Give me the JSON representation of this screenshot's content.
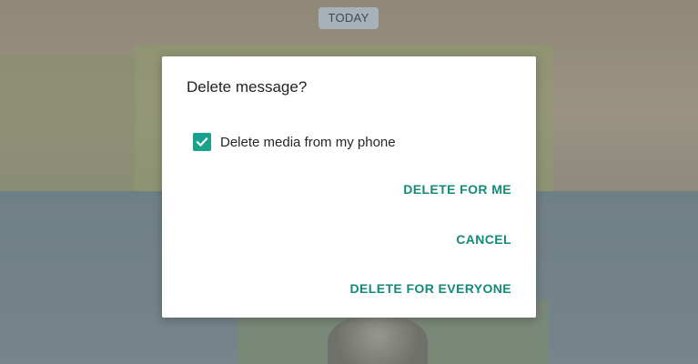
{
  "chat": {
    "date_chip": "TODAY"
  },
  "dialog": {
    "title": "Delete message?",
    "checkbox": {
      "label": "Delete media from my phone",
      "checked": true
    },
    "actions": {
      "delete_for_me": "DELETE FOR ME",
      "cancel": "CANCEL",
      "delete_for_everyone": "DELETE FOR EVERYONE"
    }
  },
  "colors": {
    "accent": "#1aa38c",
    "action_text": "#138a7a"
  }
}
